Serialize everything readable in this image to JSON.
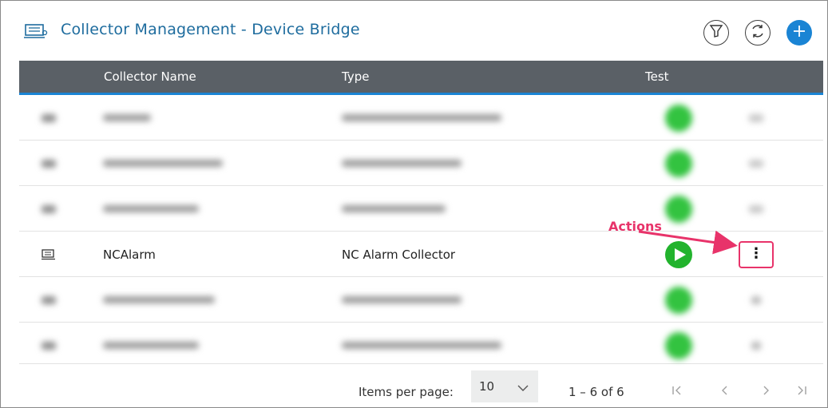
{
  "header": {
    "title": "Collector Management - Device Bridge",
    "icons": {
      "app": "collector-icon",
      "filter": "filter-icon",
      "refresh": "refresh-icon",
      "add": "plus-icon"
    },
    "add_color": "#1a84d4"
  },
  "table": {
    "columns": [
      "",
      "Collector Name",
      "Type",
      "Test",
      ""
    ],
    "rows": [
      {
        "name": "NCAlarm",
        "type": "NC Alarm Collector",
        "test_icon": "play-icon",
        "action_icon": "more-vert-icon"
      }
    ],
    "header_bg": "#5a6066",
    "accent": "#1a84d4",
    "play_color": "#22b32d"
  },
  "annotation": {
    "label": "Actions",
    "color": "#e8336a"
  },
  "paginator": {
    "items_per_page_label": "Items per page:",
    "items_per_page_value": "10",
    "range": "1 – 6 of 6",
    "icons": [
      "first-page-icon",
      "previous-page-icon",
      "next-page-icon",
      "last-page-icon"
    ]
  }
}
